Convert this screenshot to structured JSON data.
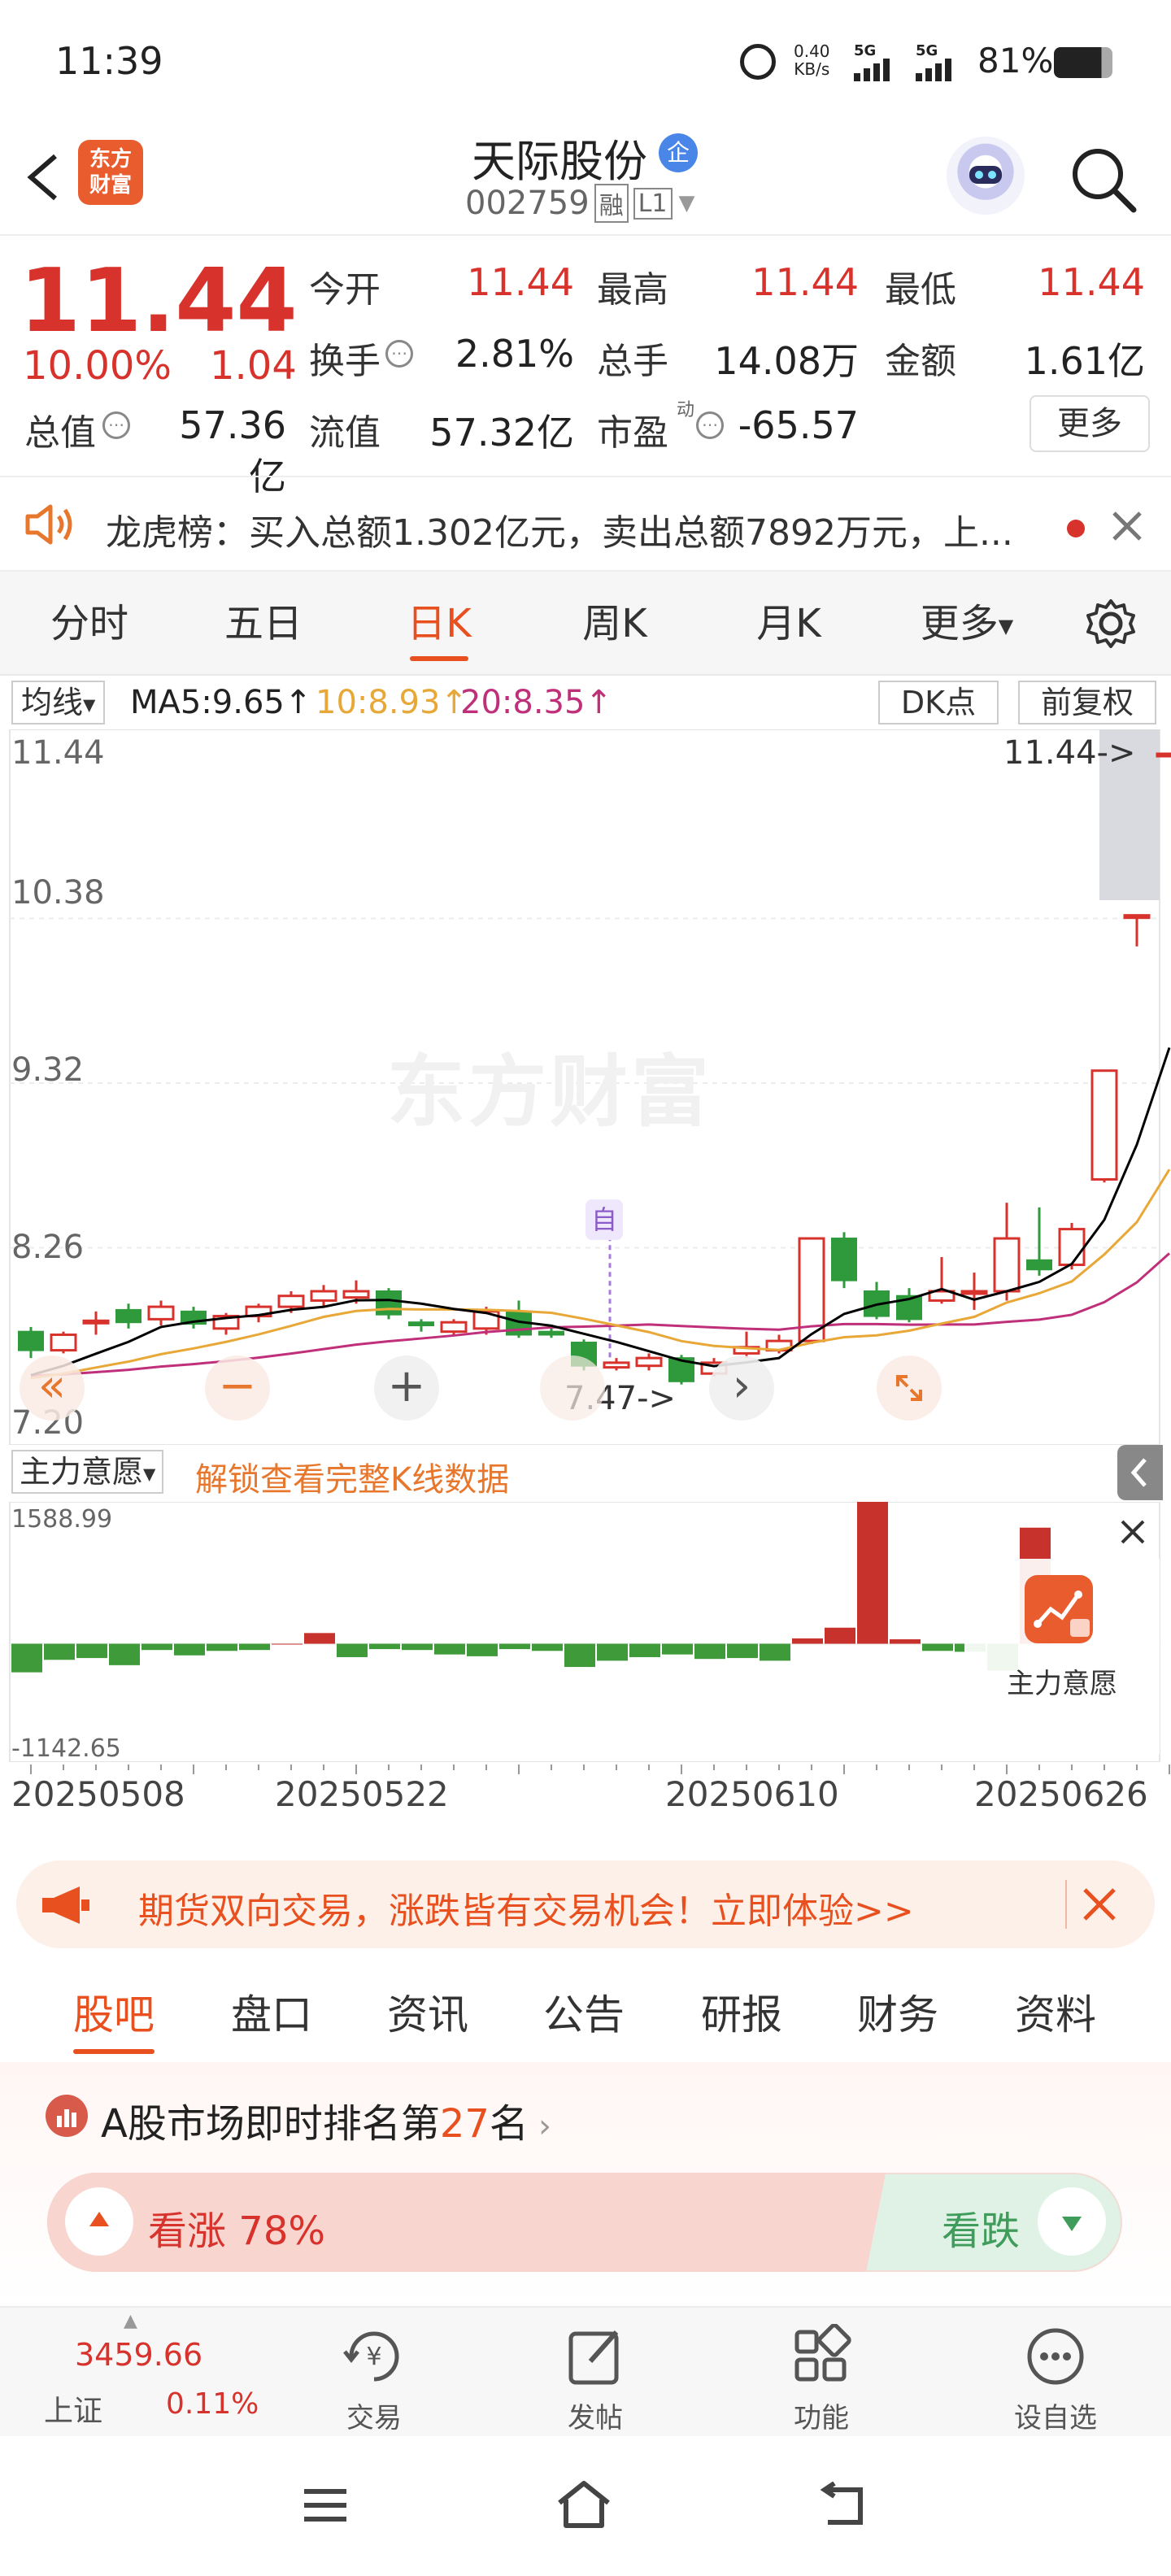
{
  "status_bar": {
    "time": "11:39",
    "net_speed_value": "0.40",
    "net_speed_unit": "KB/s",
    "sig1": "5G",
    "sig2": "5G",
    "battery": "81%"
  },
  "header": {
    "logo_line1": "东方",
    "logo_line2": "财富",
    "stock_name": "天际股份",
    "name_badge": "企",
    "stock_code": "002759",
    "tag_rong": "融",
    "tag_level": "L1"
  },
  "quote": {
    "price": "11.44",
    "change_pct": "10.00%",
    "change_amt": "1.04",
    "open_label": "今开",
    "open": "11.44",
    "high_label": "最高",
    "high": "11.44",
    "low_label": "最低",
    "low": "11.44",
    "turnover_label": "换手",
    "turnover": "2.81%",
    "vol_label": "总手",
    "vol": "14.08万",
    "amount_label": "金额",
    "amount": "1.61亿",
    "mcap_label": "总值",
    "mcap": "57.36亿",
    "float_label": "流值",
    "float": "57.32亿",
    "pe_label": "市盈",
    "pe_super": "动",
    "pe": "-65.57",
    "more_button": "更多"
  },
  "notice": {
    "text": "龙虎榜：买入总额1.302亿元，卖出总额7892万元，上..."
  },
  "chart_tabs": [
    "分时",
    "五日",
    "日K",
    "周K",
    "月K",
    "更多"
  ],
  "active_chart_tab": 2,
  "ma_bar": {
    "indicator": "均线",
    "ma5": "MA5:9.65",
    "ma10": "10:8.93",
    "ma20": "20:8.35",
    "arrow": "↑",
    "dk_button": "DK点",
    "fq_button": "前复权"
  },
  "chart_data": {
    "type": "candlestick",
    "y_ticks": [
      "11.44",
      "10.38",
      "9.32",
      "8.26",
      "7.20"
    ],
    "ylim": [
      7.2,
      11.44
    ],
    "annotations": {
      "high_label": "11.44->",
      "low_label": "7.47->",
      "marker": "自",
      "watermark": "东方财富"
    },
    "candles": [
      {
        "o": 7.72,
        "c": 7.6,
        "h": 7.75,
        "l": 7.55
      },
      {
        "o": 7.6,
        "c": 7.7,
        "h": 7.72,
        "l": 7.58
      },
      {
        "o": 7.78,
        "c": 7.79,
        "h": 7.85,
        "l": 7.7
      },
      {
        "o": 7.86,
        "c": 7.78,
        "h": 7.9,
        "l": 7.74
      },
      {
        "o": 7.8,
        "c": 7.88,
        "h": 7.92,
        "l": 7.76
      },
      {
        "o": 7.85,
        "c": 7.77,
        "h": 7.88,
        "l": 7.74
      },
      {
        "o": 7.74,
        "c": 7.82,
        "h": 7.84,
        "l": 7.7
      },
      {
        "o": 7.82,
        "c": 7.88,
        "h": 7.9,
        "l": 7.78
      },
      {
        "o": 7.88,
        "c": 7.95,
        "h": 7.98,
        "l": 7.84
      },
      {
        "o": 7.92,
        "c": 7.98,
        "h": 8.02,
        "l": 7.88
      },
      {
        "o": 7.94,
        "c": 7.98,
        "h": 8.05,
        "l": 7.9
      },
      {
        "o": 7.98,
        "c": 7.83,
        "h": 8.0,
        "l": 7.8
      },
      {
        "o": 7.78,
        "c": 7.76,
        "h": 7.8,
        "l": 7.72
      },
      {
        "o": 7.72,
        "c": 7.78,
        "h": 7.8,
        "l": 7.7
      },
      {
        "o": 7.74,
        "c": 7.85,
        "h": 7.88,
        "l": 7.7
      },
      {
        "o": 7.85,
        "c": 7.7,
        "h": 7.92,
        "l": 7.68
      },
      {
        "o": 7.72,
        "c": 7.7,
        "h": 7.75,
        "l": 7.68
      },
      {
        "o": 7.65,
        "c": 7.5,
        "h": 7.67,
        "l": 7.47
      },
      {
        "o": 7.49,
        "c": 7.52,
        "h": 7.55,
        "l": 7.47
      },
      {
        "o": 7.5,
        "c": 7.55,
        "h": 7.58,
        "l": 7.47
      },
      {
        "o": 7.55,
        "c": 7.4,
        "h": 7.57,
        "l": 7.38
      },
      {
        "o": 7.45,
        "c": 7.52,
        "h": 7.55,
        "l": 7.43
      },
      {
        "o": 7.58,
        "c": 7.62,
        "h": 7.72,
        "l": 7.55
      },
      {
        "o": 7.6,
        "c": 7.66,
        "h": 7.7,
        "l": 7.58
      },
      {
        "o": 7.66,
        "c": 8.32,
        "h": 8.32,
        "l": 7.64
      },
      {
        "o": 8.32,
        "c": 8.05,
        "h": 8.36,
        "l": 8.0
      },
      {
        "o": 7.98,
        "c": 7.82,
        "h": 8.04,
        "l": 7.8
      },
      {
        "o": 7.95,
        "c": 7.8,
        "h": 8.0,
        "l": 7.78
      },
      {
        "o": 7.92,
        "c": 7.98,
        "h": 8.2,
        "l": 7.9
      },
      {
        "o": 7.98,
        "c": 7.98,
        "h": 8.1,
        "l": 7.86
      },
      {
        "o": 7.98,
        "c": 8.32,
        "h": 8.55,
        "l": 7.92
      },
      {
        "o": 8.18,
        "c": 8.12,
        "h": 8.52,
        "l": 8.08
      },
      {
        "o": 8.15,
        "c": 8.38,
        "h": 8.42,
        "l": 8.12
      },
      {
        "o": 8.7,
        "c": 9.4,
        "h": 9.4,
        "l": 8.68
      },
      {
        "o": 10.4,
        "c": 10.4,
        "h": 10.4,
        "l": 10.2
      },
      {
        "o": 11.44,
        "c": 11.44,
        "h": 11.44,
        "l": 11.44
      }
    ],
    "ma5_color": "#000000",
    "ma10_color": "#e8a838",
    "ma20_color": "#c0307a"
  },
  "chart_controls": {
    "left": "«",
    "minus": "−",
    "plus": "+",
    "next": "›"
  },
  "main_force": {
    "label": "主力意愿",
    "unlock": "解锁查看完整K线数据",
    "max": "1588.99",
    "min": "-1142.65",
    "side_label": "主力意愿",
    "values": [
      -320,
      -180,
      -160,
      -240,
      -70,
      -130,
      -80,
      -70,
      0,
      120,
      -150,
      -60,
      -70,
      -120,
      -140,
      -60,
      -80,
      -260,
      -190,
      -150,
      -120,
      -170,
      -160,
      -190,
      60,
      180,
      1588.99,
      50,
      -80,
      -90,
      -300,
      1300
    ]
  },
  "dates": [
    "20250508",
    "20250522",
    "20250610",
    "20250626"
  ],
  "ad": {
    "text": "期货双向交易，涨跌皆有交易机会！立即体验>>"
  },
  "bottom_tabs": [
    "股吧",
    "盘口",
    "资讯",
    "公告",
    "研报",
    "财务",
    "资料"
  ],
  "active_bottom_tab": 0,
  "rank": {
    "prefix": "A股市场即时排名第",
    "rank": "27",
    "suffix": "名",
    "bull_label": "看涨",
    "bull_pct": "78%",
    "bear_label": "看跌",
    "bull_ratio": 0.78
  },
  "bottom_nav": {
    "index_value": "3459.66",
    "index_name": "上证",
    "index_change": "0.11%",
    "trade": "交易",
    "post": "发帖",
    "func": "功能",
    "watch": "设自选"
  }
}
